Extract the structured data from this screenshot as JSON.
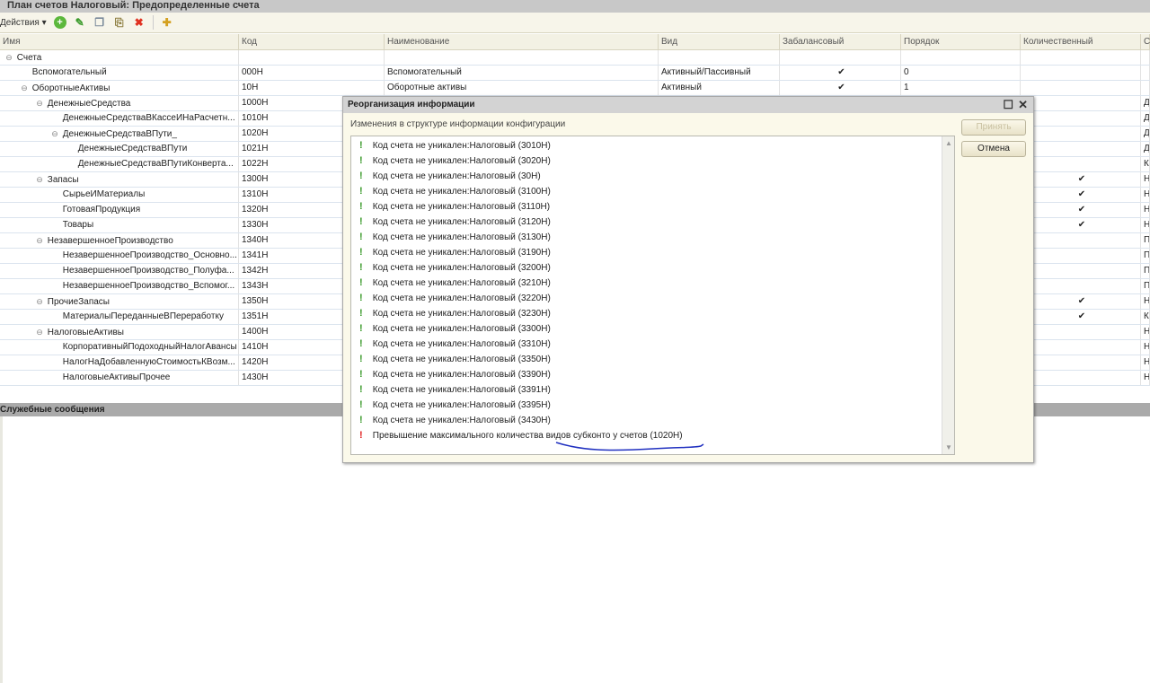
{
  "window": {
    "title": "План счетов Налоговый: Предопределенные счета"
  },
  "toolbar": {
    "actions_label": "Действия ▾",
    "icons": [
      "add-icon",
      "edit-icon",
      "copy-icon",
      "add-folder-icon",
      "delete-icon",
      "add-group-icon"
    ]
  },
  "grid": {
    "columns": [
      "Имя",
      "Код",
      "Наименование",
      "Вид",
      "Забалансовый",
      "Порядок",
      "Количественный",
      "С"
    ],
    "rows": [
      {
        "level": 0,
        "toggle": true,
        "name": "Счета",
        "code": "",
        "title": "",
        "kind": "",
        "offbalance": "",
        "order": "",
        "qty": "",
        "last": ""
      },
      {
        "level": 1,
        "toggle": false,
        "name": "Вспомогательный",
        "code": "000Н",
        "title": "Вспомогательный",
        "kind": "Активный/Пассивный",
        "offbalance": "✔",
        "order": "0",
        "qty": "",
        "last": ""
      },
      {
        "level": 1,
        "toggle": true,
        "name": "ОборотныеАктивы",
        "code": "10Н",
        "title": "Оборотные активы",
        "kind": "Активный",
        "offbalance": "✔",
        "order": "1",
        "qty": "",
        "last": ""
      },
      {
        "level": 2,
        "toggle": true,
        "name": "ДенежныеСредства",
        "code": "1000Н",
        "qty": "",
        "last": "Д"
      },
      {
        "level": 3,
        "toggle": false,
        "name": "ДенежныеСредстваВКассеИНаРасчетн...",
        "code": "1010Н",
        "qty": "",
        "last": "Д"
      },
      {
        "level": 3,
        "toggle": true,
        "name": "ДенежныеСредстваВПути_",
        "code": "1020Н",
        "qty": "",
        "last": "Д"
      },
      {
        "level": 4,
        "toggle": false,
        "name": "ДенежныеСредстваВПути",
        "code": "1021Н",
        "qty": "",
        "last": "Д"
      },
      {
        "level": 4,
        "toggle": false,
        "name": "ДенежныеСредстваВПутиКонверта...",
        "code": "1022Н",
        "qty": "",
        "last": "К"
      },
      {
        "level": 2,
        "toggle": true,
        "name": "Запасы",
        "code": "1300Н",
        "qty": "✔",
        "last": "Н"
      },
      {
        "level": 3,
        "toggle": false,
        "name": "СырьеИМатериалы",
        "code": "1310Н",
        "qty": "✔",
        "last": "Н"
      },
      {
        "level": 3,
        "toggle": false,
        "name": "ГотоваяПродукция",
        "code": "1320Н",
        "qty": "✔",
        "last": "Н"
      },
      {
        "level": 3,
        "toggle": false,
        "name": "Товары",
        "code": "1330Н",
        "qty": "✔",
        "last": "Н"
      },
      {
        "level": 2,
        "toggle": true,
        "name": "НезавершенноеПроизводство",
        "code": "1340Н",
        "qty": "",
        "last": "П"
      },
      {
        "level": 3,
        "toggle": false,
        "name": "НезавершенноеПроизводство_Основно...",
        "code": "1341Н",
        "qty": "",
        "last": "П"
      },
      {
        "level": 3,
        "toggle": false,
        "name": "НезавершенноеПроизводство_Полуфа...",
        "code": "1342Н",
        "qty": "",
        "last": "П"
      },
      {
        "level": 3,
        "toggle": false,
        "name": "НезавершенноеПроизводство_Вспомог...",
        "code": "1343Н",
        "qty": "",
        "last": "П"
      },
      {
        "level": 2,
        "toggle": true,
        "name": "ПрочиеЗапасы",
        "code": "1350Н",
        "qty": "✔",
        "last": "Н"
      },
      {
        "level": 3,
        "toggle": false,
        "name": "МатериалыПереданныеВПереработку",
        "code": "1351Н",
        "qty": "✔",
        "last": "К"
      },
      {
        "level": 2,
        "toggle": true,
        "name": "НалоговыеАктивы",
        "code": "1400Н",
        "qty": "",
        "last": "Н"
      },
      {
        "level": 3,
        "toggle": false,
        "name": "КорпоративныйПодоходныйНалогАвансы",
        "code": "1410Н",
        "qty": "",
        "last": "Н"
      },
      {
        "level": 3,
        "toggle": false,
        "name": "НалогНаДобавленнуюСтоимостьКВозм...",
        "code": "1420Н",
        "qty": "",
        "last": "Н"
      },
      {
        "level": 3,
        "toggle": false,
        "name": "НалоговыеАктивыПрочее",
        "code": "1430Н",
        "qty": "",
        "last": "Н"
      }
    ]
  },
  "messages_panel": {
    "title": "Служебные сообщения"
  },
  "dialog": {
    "title": "Реорганизация информации",
    "subtitle": "Изменения в структуре информации конфигурации",
    "accept_label": "Принять",
    "cancel_label": "Отмена",
    "colors": {
      "warning": "#3a9a2a",
      "error": "#e02020"
    },
    "items": [
      {
        "severity": "warning",
        "text": "Код счета не уникален:Налоговый (3010Н)"
      },
      {
        "severity": "warning",
        "text": "Код счета не уникален:Налоговый (3020Н)"
      },
      {
        "severity": "warning",
        "text": "Код счета не уникален:Налоговый (30Н)"
      },
      {
        "severity": "warning",
        "text": "Код счета не уникален:Налоговый (3100Н)"
      },
      {
        "severity": "warning",
        "text": "Код счета не уникален:Налоговый (3110Н)"
      },
      {
        "severity": "warning",
        "text": "Код счета не уникален:Налоговый (3120Н)"
      },
      {
        "severity": "warning",
        "text": "Код счета не уникален:Налоговый (3130Н)"
      },
      {
        "severity": "warning",
        "text": "Код счета не уникален:Налоговый (3190Н)"
      },
      {
        "severity": "warning",
        "text": "Код счета не уникален:Налоговый (3200Н)"
      },
      {
        "severity": "warning",
        "text": "Код счета не уникален:Налоговый (3210Н)"
      },
      {
        "severity": "warning",
        "text": "Код счета не уникален:Налоговый (3220Н)"
      },
      {
        "severity": "warning",
        "text": "Код счета не уникален:Налоговый (3230Н)"
      },
      {
        "severity": "warning",
        "text": "Код счета не уникален:Налоговый (3300Н)"
      },
      {
        "severity": "warning",
        "text": "Код счета не уникален:Налоговый (3310Н)"
      },
      {
        "severity": "warning",
        "text": "Код счета не уникален:Налоговый (3350Н)"
      },
      {
        "severity": "warning",
        "text": "Код счета не уникален:Налоговый (3390Н)"
      },
      {
        "severity": "warning",
        "text": "Код счета не уникален:Налоговый (3391Н)"
      },
      {
        "severity": "warning",
        "text": "Код счета не уникален:Налоговый (3395Н)"
      },
      {
        "severity": "warning",
        "text": "Код счета не уникален:Налоговый (3430Н)"
      },
      {
        "severity": "error",
        "text": "Превышение максимального количества видов субконто у счетов (1020Н)"
      }
    ]
  }
}
